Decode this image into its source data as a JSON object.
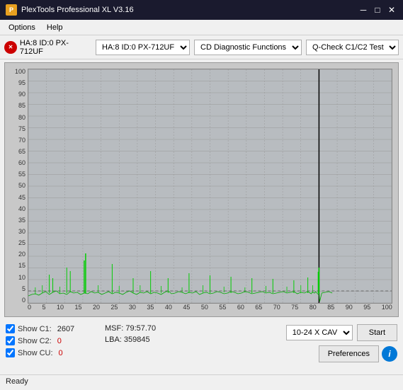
{
  "window": {
    "title": "PlexTools Professional XL V3.16",
    "minimize_label": "─",
    "restore_label": "□",
    "close_label": "✕"
  },
  "menu": {
    "options_label": "Options",
    "help_label": "Help"
  },
  "toolbar": {
    "drive_id": "HA:8 ID:0  PX-712UF",
    "function_label": "CD Diagnostic Functions",
    "test_label": "Q-Check C1/C2 Test"
  },
  "chart": {
    "y_labels": [
      "100",
      "95",
      "90",
      "85",
      "80",
      "75",
      "70",
      "65",
      "60",
      "55",
      "50",
      "45",
      "40",
      "35",
      "30",
      "25",
      "20",
      "15",
      "10",
      "5",
      "0"
    ],
    "x_labels": [
      "0",
      "5",
      "10",
      "15",
      "20",
      "25",
      "30",
      "35",
      "40",
      "45",
      "50",
      "55",
      "60",
      "65",
      "70",
      "75",
      "80",
      "85",
      "90",
      "95",
      "100"
    ]
  },
  "stats": {
    "show_c1_label": "Show C1:",
    "show_c2_label": "Show C2:",
    "show_cu_label": "Show CU:",
    "c1_value": "2607",
    "c2_value": "0",
    "cu_value": "0",
    "msf_label": "MSF:",
    "msf_value": "79:57.70",
    "lba_label": "LBA:",
    "lba_value": "359845"
  },
  "controls": {
    "speed_label": "10-24 X CAV",
    "start_label": "Start",
    "preferences_label": "Preferences",
    "info_label": "i"
  },
  "status": {
    "text": "Ready"
  }
}
